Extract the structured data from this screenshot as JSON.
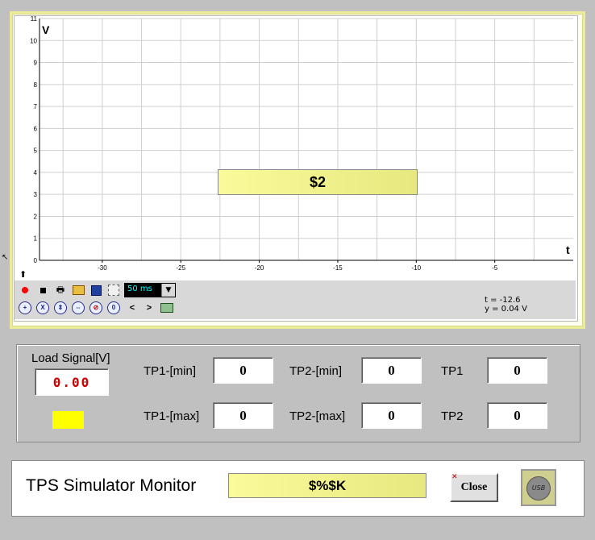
{
  "colors": {
    "background": "#c0c0c0",
    "chart_bg": "#ffffff",
    "grid": "#c8c8c8",
    "status_yellow": "#f8f890",
    "indicator_yellow": "#ffff00",
    "digital_red": "#cc0000"
  },
  "chart_data": {
    "type": "line",
    "xlabel": "t",
    "ylabel": "V",
    "xlim": [
      -34,
      0
    ],
    "ylim": [
      0,
      11
    ],
    "x_ticks": [
      -30,
      -25,
      -20,
      -15,
      -10,
      -5
    ],
    "y_ticks": [
      0,
      1,
      2,
      3,
      4,
      5,
      6,
      7,
      8,
      9,
      10,
      11
    ],
    "grid": true,
    "series": [],
    "overlay_label": "$2"
  },
  "toolbar": {
    "record_icon": "record-icon",
    "stop_icon": "stop-icon",
    "print_icon": "print-icon",
    "open_icon": "folder-open-icon",
    "save_icon": "save-icon",
    "export_icon": "export-icon",
    "interval_value": "50 ms",
    "zoom_icons": [
      "zoom-in-icon",
      "zoom-x-icon",
      "zoom-y-in-icon",
      "zoom-y-out-icon",
      "zoom-reset-icon",
      "zoom-fit-icon"
    ],
    "prev_label": "<",
    "next_label": ">",
    "readout_t": "t = -12.6",
    "readout_y": "y = 0.04 V"
  },
  "panel": {
    "load_signal_label": "Load Signal[V]",
    "load_signal_value": "0.00",
    "tp1_min_label": "TP1-[min]",
    "tp1_min_value": "0",
    "tp1_max_label": "TP1-[max]",
    "tp1_max_value": "0",
    "tp2_min_label": "TP2-[min]",
    "tp2_min_value": "0",
    "tp2_max_label": "TP2-[max]",
    "tp2_max_value": "0",
    "tp1_label": "TP1",
    "tp1_value": "0",
    "tp2_label": "TP2",
    "tp2_value": "0"
  },
  "footer": {
    "title": "TPS Simulator Monitor",
    "status": "$%$K",
    "close_label": "Close",
    "usb_label": "USB"
  }
}
